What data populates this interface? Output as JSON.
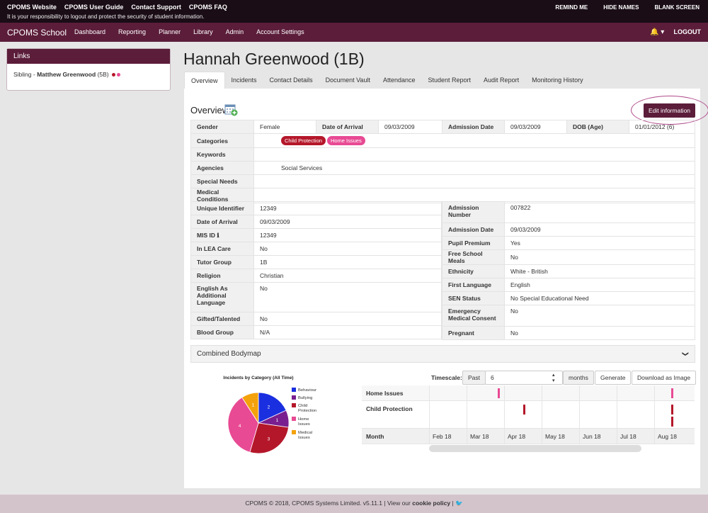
{
  "topbar": {
    "links": [
      "CPOMS Website",
      "CPOMS User Guide",
      "Contact Support",
      "CPOMS FAQ"
    ],
    "notice": "It is your responsibility to logout and protect the security of student information.",
    "right": [
      "REMIND ME",
      "HIDE NAMES",
      "BLANK SCREEN"
    ]
  },
  "nav": {
    "brand": "CPOMS School",
    "items": [
      "Dashboard",
      "Reporting",
      "Planner",
      "Library",
      "Admin",
      "Account Settings"
    ],
    "logout": "LOGOUT",
    "bell": "🔔 ▾"
  },
  "links_panel": {
    "title": "Links",
    "sibling_prefix": "Sibling - ",
    "sibling_name": "Matthew Greenwood",
    "sibling_group": "(5B)"
  },
  "student": {
    "name": "Hannah Greenwood (1B)"
  },
  "tabs": [
    "Overview",
    "Incidents",
    "Contact Details",
    "Document Vault",
    "Attendance",
    "Student Report",
    "Audit Report",
    "Monitoring History"
  ],
  "overview": {
    "title": "Overview",
    "edit_button": "Edit information"
  },
  "summary": {
    "gender_label": "Gender",
    "gender": "Female",
    "doa_label": "Date of Arrival",
    "doa": "09/03/2009",
    "admission_label": "Admission Date",
    "admission": "09/03/2009",
    "dob_label": "DOB (Age)",
    "dob": "01/01/2012 (6)",
    "categories_label": "Categories",
    "categories": [
      {
        "label": "Child Protection",
        "color": "#b5172a"
      },
      {
        "label": "Home Issues",
        "color": "#e84a94"
      }
    ],
    "keywords_label": "Keywords",
    "agencies_label": "Agencies",
    "agencies": "Social Services",
    "special_needs_label": "Special Needs",
    "medical_label": "Medical Conditions"
  },
  "details_left": [
    {
      "label": "Unique Identifier",
      "value": "12349"
    },
    {
      "label": "Date of Arrival",
      "value": "09/03/2009"
    },
    {
      "label": "MIS ID ℹ",
      "value": "12349"
    },
    {
      "label": "In LEA Care",
      "value": "No"
    },
    {
      "label": "Tutor Group",
      "value": "1B"
    },
    {
      "label": "Religion",
      "value": "Christian"
    },
    {
      "label": "English As Additional Language",
      "value": "No"
    },
    {
      "label": "Gifted/Talented",
      "value": "No"
    },
    {
      "label": "Blood Group",
      "value": "N/A"
    }
  ],
  "details_right": [
    {
      "label": "Admission Number",
      "value": "007822"
    },
    {
      "label": "Admission Date",
      "value": "09/03/2009"
    },
    {
      "label": "Pupil Premium",
      "value": "Yes"
    },
    {
      "label": "Free School Meals",
      "value": "No"
    },
    {
      "label": "Ethnicity",
      "value": "White - British"
    },
    {
      "label": "First Language",
      "value": "English"
    },
    {
      "label": "SEN Status",
      "value": "No Special Educational Need"
    },
    {
      "label": "Emergency Medical Consent",
      "value": "No"
    },
    {
      "label": "Pregnant",
      "value": "No"
    }
  ],
  "bodymap": {
    "title": "Combined Bodymap",
    "chevron": "❯"
  },
  "chart_data": {
    "type": "pie",
    "title": "Incidents by Category (All Time)",
    "categories": [
      "Behaviour",
      "Bullying",
      "Child Protection",
      "Home Issues",
      "Medical Issues"
    ],
    "values": [
      2,
      1,
      3,
      4,
      1
    ],
    "colors": [
      "#1a2fe0",
      "#7a1f8f",
      "#b5172a",
      "#e84a94",
      "#f4a20c"
    ],
    "legend": "right"
  },
  "timeline": {
    "timescale_label": "Timescale:",
    "past_label": "Past",
    "past_value": "6",
    "months_label": "months",
    "generate_label": "Generate",
    "download_label": "Download as Image",
    "rows": [
      "Home Issues",
      "Child Protection"
    ],
    "month_label": "Month",
    "months": [
      "Feb 18",
      "Mar 18",
      "Apr 18",
      "May 18",
      "Jun 18",
      "Jul 18",
      "Aug 18"
    ],
    "events": [
      {
        "row": "Home Issues",
        "date": "Mar 18",
        "color": "#e84a94"
      },
      {
        "row": "Home Issues",
        "date": "Aug 18",
        "color": "#e84a94"
      },
      {
        "row": "Child Protection",
        "date": "Apr 18",
        "color": "#b5172a"
      },
      {
        "row": "Child Protection",
        "date": "Aug 18",
        "color": "#b5172a"
      },
      {
        "row": "Child Protection",
        "date": "Aug 18",
        "color": "#b5172a"
      }
    ]
  },
  "footer": {
    "text": "CPOMS © 2018, CPOMS Systems Limited. v5.11.1 | View our ",
    "link": "cookie policy",
    "suffix": " | "
  }
}
